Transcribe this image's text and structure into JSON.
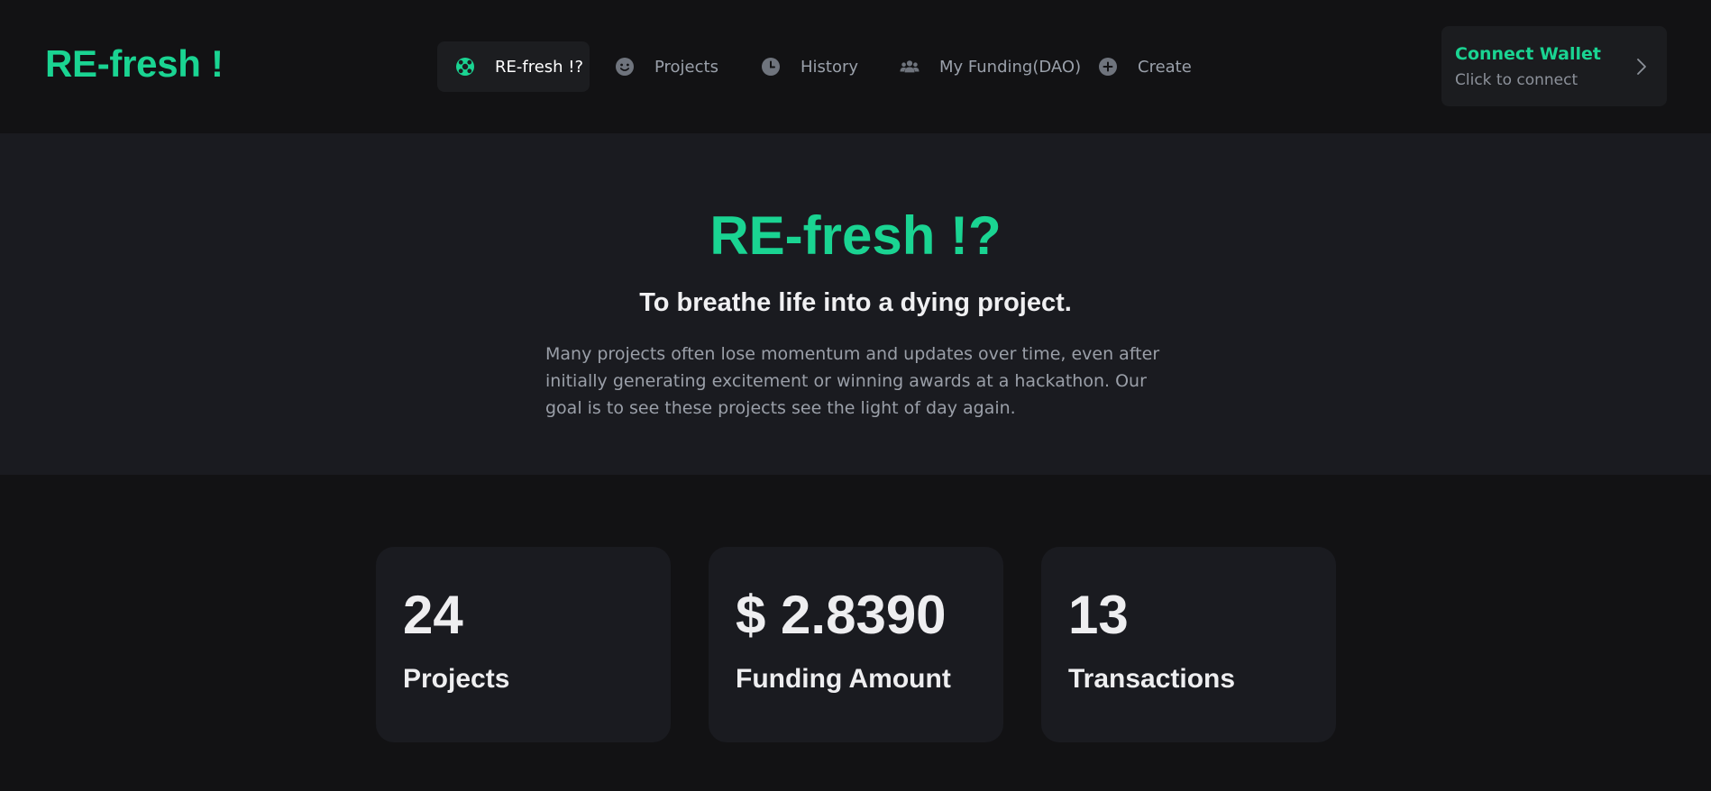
{
  "app": {
    "logo_text": "RE-fresh !"
  },
  "nav": {
    "items": [
      {
        "label": "RE-fresh !?",
        "icon": "lifebuoy-icon",
        "active": true
      },
      {
        "label": "Projects",
        "icon": "smiley-icon",
        "active": false
      },
      {
        "label": "History",
        "icon": "clock-icon",
        "active": false
      },
      {
        "label": "My Funding(DAO)",
        "icon": "users-icon",
        "active": false
      },
      {
        "label": "Create",
        "icon": "plus-circle-icon",
        "active": false
      }
    ]
  },
  "wallet": {
    "title": "Connect Wallet",
    "subtitle": "Click to connect",
    "icon": "chevron-right-icon"
  },
  "hero": {
    "title": "RE-fresh !?",
    "subtitle": "To breathe life into a dying project.",
    "description": "Many projects often lose momentum and updates over time, even after initially generating excitement or winning awards at a hackathon. Our goal is to see these projects see the light of day again."
  },
  "stats": [
    {
      "value": "24",
      "label": "Projects"
    },
    {
      "value": "$ 2.8390",
      "label": "Funding Amount"
    },
    {
      "value": "13",
      "label": "Transactions"
    }
  ],
  "colors": {
    "accent": "#1ad492",
    "background": "#121214",
    "surface": "#1a1b20",
    "muted_text": "#9aa0aa"
  }
}
